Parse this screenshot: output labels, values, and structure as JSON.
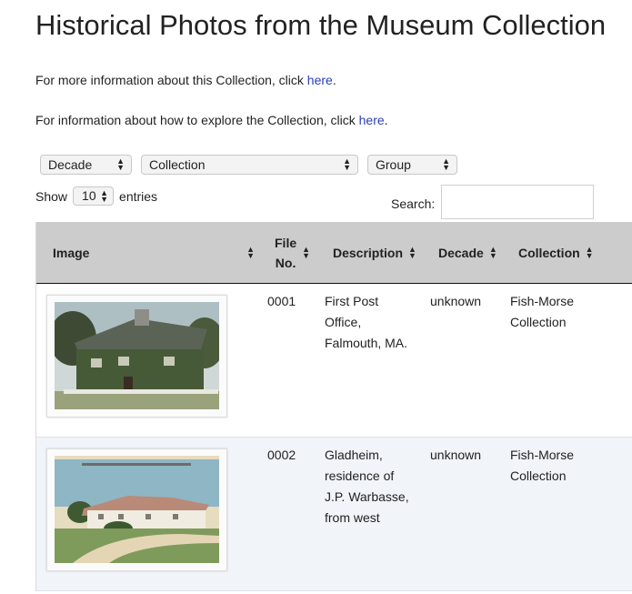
{
  "page": {
    "title": "Historical Photos from the Museum Collection",
    "info1": {
      "text": "For more information about this Collection, click ",
      "link": "here",
      "tail": "."
    },
    "info2": {
      "text": "For information about how to explore the Collection, click ",
      "link": "here",
      "tail": "."
    }
  },
  "filters": {
    "decade": "Decade",
    "collection": "Collection",
    "group": "Group"
  },
  "length": {
    "show": "Show",
    "value": "10",
    "entries": "entries"
  },
  "search": {
    "label": "Search:",
    "value": "",
    "placeholder": ""
  },
  "table": {
    "headers": {
      "image": "Image",
      "file_no_1": "File",
      "file_no_2": "No.",
      "description": "Description",
      "decade": "Decade",
      "collection": "Collection"
    },
    "rows": [
      {
        "file_no": "0001",
        "description": [
          "First Post",
          "Office,",
          "Falmouth, MA."
        ],
        "decade": "unknown",
        "collection": [
          "Fish-Morse",
          "Collection"
        ]
      },
      {
        "file_no": "0002",
        "description": [
          "Gladheim,",
          "residence of",
          "J.P. Warbasse,",
          "from west"
        ],
        "decade": "unknown",
        "collection": [
          "Fish-Morse",
          "Collection"
        ]
      }
    ]
  },
  "icons": {
    "sort": "sort-both-icon",
    "select_arrows": "select-arrows-icon"
  },
  "colors": {
    "link": "#2a3fb8",
    "header_bg": "#cccccc",
    "row_alt_bg": "#f1f4f9"
  }
}
